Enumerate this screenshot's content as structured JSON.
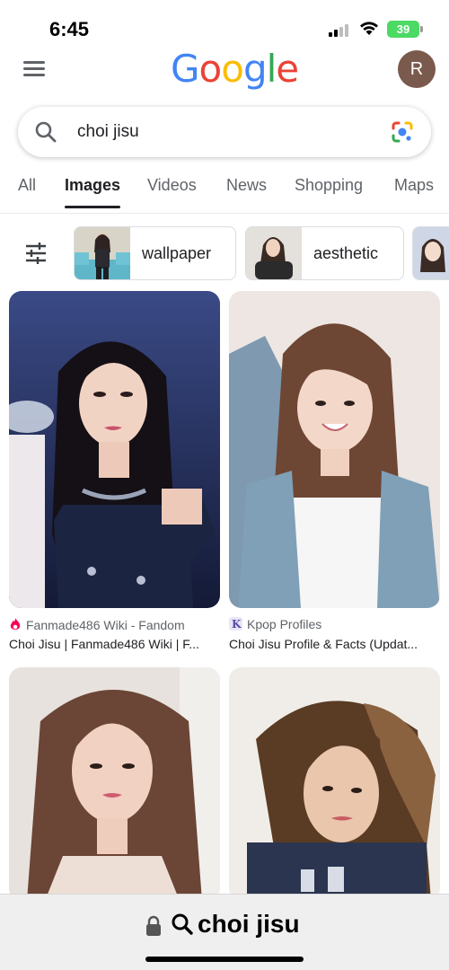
{
  "status": {
    "time": "6:45",
    "battery": "39"
  },
  "header": {
    "logo": "Google",
    "avatar_letter": "R"
  },
  "search": {
    "query": "choi jisu"
  },
  "tabs": [
    {
      "label": "All",
      "active": false
    },
    {
      "label": "Images",
      "active": true
    },
    {
      "label": "Videos",
      "active": false
    },
    {
      "label": "News",
      "active": false
    },
    {
      "label": "Shopping",
      "active": false
    },
    {
      "label": "Maps",
      "active": false
    }
  ],
  "chips": [
    {
      "label": "wallpaper"
    },
    {
      "label": "aesthetic"
    }
  ],
  "results": [
    {
      "source": "Fanmade486 Wiki - Fandom",
      "title": "Choi Jisu | Fanmade486 Wiki | F...",
      "icon": "fandom-flame-icon"
    },
    {
      "source": "Kpop Profiles",
      "title": "Choi Jisu Profile & Facts (Updat...",
      "icon": "kpop-profiles-k-icon"
    },
    {
      "source": "",
      "title": "",
      "icon": ""
    },
    {
      "source": "",
      "title": "",
      "icon": ""
    }
  ],
  "bottom_bar": {
    "url_text": "choi jisu"
  },
  "colors": {
    "google_blue": "#4285f4",
    "google_red": "#ea4335",
    "google_yellow": "#fbbc05",
    "google_green": "#34a853",
    "battery_green": "#4cd964",
    "avatar_brown": "#7a5a4c"
  }
}
